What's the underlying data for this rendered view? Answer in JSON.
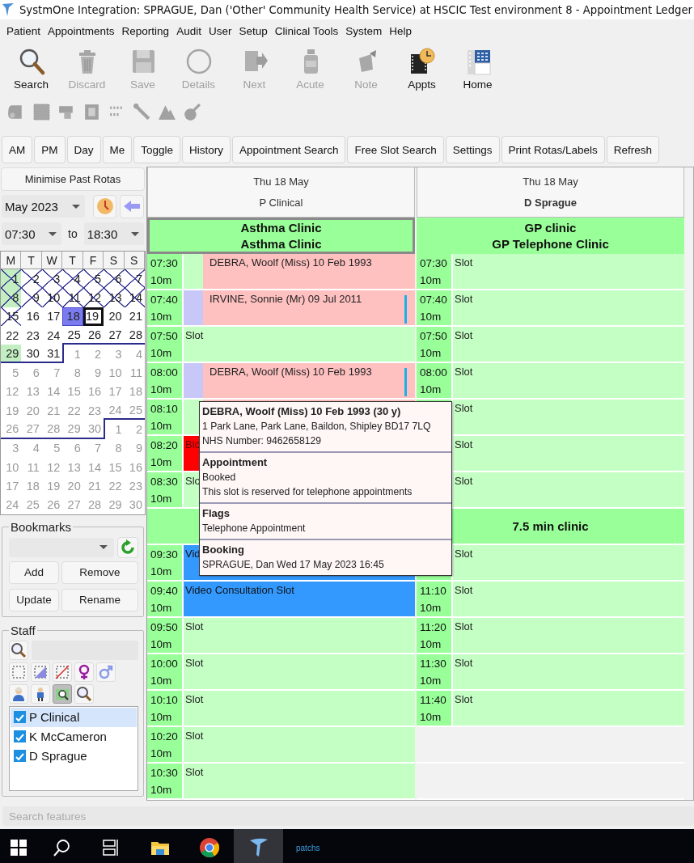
{
  "window": {
    "title": "SystmOne Integration: SPRAGUE, Dan ('Other' Community Health Service) at HSCIC Test environment 8 - Appointment Ledger"
  },
  "menu": [
    "Patient",
    "Appointments",
    "Reporting",
    "Audit",
    "User",
    "Setup",
    "Clinical Tools",
    "System",
    "Help"
  ],
  "toolbar": [
    {
      "kind": "search",
      "label": "Search",
      "disabled": false
    },
    {
      "kind": "discard",
      "label": "Discard",
      "disabled": true
    },
    {
      "kind": "save",
      "label": "Save",
      "disabled": true
    },
    {
      "kind": "details",
      "label": "Details",
      "disabled": true
    },
    {
      "kind": "next",
      "label": "Next",
      "disabled": true
    },
    {
      "kind": "acute",
      "label": "Acute",
      "disabled": true
    },
    {
      "kind": "note",
      "label": "Note",
      "disabled": true
    },
    {
      "kind": "appts",
      "label": "Appts",
      "disabled": false
    },
    {
      "kind": "home",
      "label": "Home",
      "disabled": false
    }
  ],
  "small_tools": [
    {
      "kind": "scroll",
      "disabled": true
    },
    {
      "kind": "grid",
      "disabled": true
    },
    {
      "kind": "stamp",
      "disabled": true
    },
    {
      "kind": "frame",
      "disabled": true
    },
    {
      "kind": "numbers",
      "disabled": true
    },
    {
      "kind": "tool",
      "disabled": true
    },
    {
      "kind": "mountain",
      "disabled": true
    },
    {
      "kind": "pestle",
      "disabled": true
    }
  ],
  "ledger_buttons": [
    "AM",
    "PM",
    "Day",
    "Me",
    "Toggle",
    "History",
    "Appointment Search",
    "Free Slot Search",
    "Settings",
    "Print Rotas/Labels",
    "Refresh"
  ],
  "navigator": {
    "minimise_button": "Minimise Past Rotas",
    "month": "May 2023",
    "time_from": "07:30",
    "to_label": "to",
    "time_to": "18:30",
    "calendar": {
      "weekdays": [
        "M",
        "T",
        "W",
        "T",
        "F",
        "S",
        "S"
      ],
      "weeks": [
        {
          "days": [
            {
              "day": "1",
              "kind": "current",
              "crossed": true,
              "available": true,
              "selected": false,
              "today": false
            },
            {
              "day": "2",
              "kind": "current",
              "crossed": true,
              "available": false,
              "selected": false,
              "today": false
            },
            {
              "day": "3",
              "kind": "current",
              "crossed": true,
              "available": false,
              "selected": false,
              "today": false
            },
            {
              "day": "4",
              "kind": "current",
              "crossed": true,
              "available": false,
              "selected": false,
              "today": false
            },
            {
              "day": "5",
              "kind": "current",
              "crossed": true,
              "available": false,
              "selected": false,
              "today": false
            },
            {
              "day": "6",
              "kind": "current",
              "crossed": true,
              "available": false,
              "selected": false,
              "today": false
            },
            {
              "day": "7",
              "kind": "current",
              "crossed": true,
              "available": false,
              "selected": false,
              "today": false
            }
          ]
        },
        {
          "days": [
            {
              "day": "8",
              "kind": "current",
              "crossed": true,
              "available": true,
              "selected": false,
              "today": false
            },
            {
              "day": "9",
              "kind": "current",
              "crossed": true,
              "available": false,
              "selected": false,
              "today": false
            },
            {
              "day": "10",
              "kind": "current",
              "crossed": true,
              "available": false,
              "selected": false,
              "today": false
            },
            {
              "day": "11",
              "kind": "current",
              "crossed": true,
              "available": false,
              "selected": false,
              "today": false
            },
            {
              "day": "12",
              "kind": "current",
              "crossed": true,
              "available": false,
              "selected": false,
              "today": false
            },
            {
              "day": "13",
              "kind": "current",
              "crossed": true,
              "available": false,
              "selected": false,
              "today": false
            },
            {
              "day": "14",
              "kind": "current",
              "crossed": true,
              "available": false,
              "selected": false,
              "today": false
            }
          ]
        },
        {
          "days": [
            {
              "day": "15",
              "kind": "current",
              "crossed": true,
              "available": false,
              "selected": false,
              "today": false
            },
            {
              "day": "16",
              "kind": "current",
              "crossed": false,
              "available": false,
              "selected": false,
              "today": false
            },
            {
              "day": "17",
              "kind": "current",
              "crossed": false,
              "available": false,
              "selected": false,
              "today": false
            },
            {
              "day": "18",
              "kind": "current",
              "crossed": false,
              "available": false,
              "selected": true,
              "today": false
            },
            {
              "day": "19",
              "kind": "current",
              "crossed": false,
              "available": false,
              "selected": false,
              "today": true
            },
            {
              "day": "20",
              "kind": "current",
              "crossed": false,
              "available": false,
              "selected": false,
              "today": false
            },
            {
              "day": "21",
              "kind": "current",
              "crossed": false,
              "available": false,
              "selected": false,
              "today": false
            }
          ]
        },
        {
          "days": [
            {
              "day": "22",
              "kind": "current",
              "crossed": false,
              "available": false,
              "selected": false,
              "today": false
            },
            {
              "day": "23",
              "kind": "current",
              "crossed": false,
              "available": false,
              "selected": false,
              "today": false
            },
            {
              "day": "24",
              "kind": "current",
              "crossed": false,
              "available": false,
              "selected": false,
              "today": false
            },
            {
              "day": "25",
              "kind": "current",
              "crossed": false,
              "available": false,
              "selected": false,
              "today": false
            },
            {
              "day": "26",
              "kind": "current",
              "crossed": false,
              "available": false,
              "selected": false,
              "today": false
            },
            {
              "day": "27",
              "kind": "current",
              "crossed": false,
              "available": false,
              "selected": false,
              "today": false
            },
            {
              "day": "28",
              "kind": "current",
              "crossed": false,
              "available": false,
              "selected": false,
              "today": false
            }
          ]
        },
        {
          "days": [
            {
              "day": "29",
              "kind": "current",
              "crossed": false,
              "available": true,
              "selected": false,
              "today": false
            },
            {
              "day": "30",
              "kind": "current",
              "crossed": false,
              "available": false,
              "selected": false,
              "today": false
            },
            {
              "day": "31",
              "kind": "current",
              "crossed": false,
              "available": false,
              "selected": false,
              "today": false
            },
            {
              "day": "1",
              "kind": "next",
              "crossed": false,
              "available": false,
              "selected": false,
              "today": false
            },
            {
              "day": "2",
              "kind": "next",
              "crossed": false,
              "available": false,
              "selected": false,
              "today": false
            },
            {
              "day": "3",
              "kind": "next",
              "crossed": false,
              "available": false,
              "selected": false,
              "today": false
            },
            {
              "day": "4",
              "kind": "next",
              "crossed": false,
              "available": false,
              "selected": false,
              "today": false
            }
          ]
        },
        {
          "days": [
            {
              "day": "5",
              "kind": "next",
              "crossed": false,
              "available": false,
              "selected": false,
              "today": false
            },
            {
              "day": "6",
              "kind": "next",
              "crossed": false,
              "available": false,
              "selected": false,
              "today": false
            },
            {
              "day": "7",
              "kind": "next",
              "crossed": false,
              "available": false,
              "selected": false,
              "today": false
            },
            {
              "day": "8",
              "kind": "next",
              "crossed": false,
              "available": false,
              "selected": false,
              "today": false
            },
            {
              "day": "9",
              "kind": "next",
              "crossed": false,
              "available": false,
              "selected": false,
              "today": false
            },
            {
              "day": "10",
              "kind": "next",
              "crossed": false,
              "available": false,
              "selected": false,
              "today": false
            },
            {
              "day": "11",
              "kind": "next",
              "crossed": false,
              "available": false,
              "selected": false,
              "today": false
            }
          ]
        },
        {
          "days": [
            {
              "day": "12",
              "kind": "next",
              "crossed": false,
              "available": false,
              "selected": false,
              "today": false
            },
            {
              "day": "13",
              "kind": "next",
              "crossed": false,
              "available": false,
              "selected": false,
              "today": false
            },
            {
              "day": "14",
              "kind": "next",
              "crossed": false,
              "available": false,
              "selected": false,
              "today": false
            },
            {
              "day": "15",
              "kind": "next",
              "crossed": false,
              "available": false,
              "selected": false,
              "today": false
            },
            {
              "day": "16",
              "kind": "next",
              "crossed": false,
              "available": false,
              "selected": false,
              "today": false
            },
            {
              "day": "17",
              "kind": "next",
              "crossed": false,
              "available": false,
              "selected": false,
              "today": false
            },
            {
              "day": "18",
              "kind": "next",
              "crossed": false,
              "available": false,
              "selected": false,
              "today": false
            }
          ]
        },
        {
          "days": [
            {
              "day": "19",
              "kind": "next",
              "crossed": false,
              "available": false,
              "selected": false,
              "today": false
            },
            {
              "day": "20",
              "kind": "next",
              "crossed": false,
              "available": false,
              "selected": false,
              "today": false
            },
            {
              "day": "21",
              "kind": "next",
              "crossed": false,
              "available": false,
              "selected": false,
              "today": false
            },
            {
              "day": "22",
              "kind": "next",
              "crossed": false,
              "available": false,
              "selected": false,
              "today": false
            },
            {
              "day": "23",
              "kind": "next",
              "crossed": false,
              "available": false,
              "selected": false,
              "today": false
            },
            {
              "day": "24",
              "kind": "next",
              "crossed": false,
              "available": false,
              "selected": false,
              "today": false
            },
            {
              "day": "25",
              "kind": "next",
              "crossed": false,
              "available": false,
              "selected": false,
              "today": false
            }
          ]
        },
        {
          "days": [
            {
              "day": "26",
              "kind": "next",
              "crossed": false,
              "available": false,
              "selected": false,
              "today": false
            },
            {
              "day": "27",
              "kind": "next",
              "crossed": false,
              "available": false,
              "selected": false,
              "today": false
            },
            {
              "day": "28",
              "kind": "next",
              "crossed": false,
              "available": false,
              "selected": false,
              "today": false
            },
            {
              "day": "29",
              "kind": "next",
              "crossed": false,
              "available": false,
              "selected": false,
              "today": false
            },
            {
              "day": "30",
              "kind": "next",
              "crossed": false,
              "available": false,
              "selected": false,
              "today": false
            },
            {
              "day": "1",
              "kind": "after",
              "crossed": false,
              "available": false,
              "selected": false,
              "today": false
            },
            {
              "day": "2",
              "kind": "after",
              "crossed": false,
              "available": false,
              "selected": false,
              "today": false
            }
          ]
        },
        {
          "days": [
            {
              "day": "3",
              "kind": "after",
              "crossed": false,
              "available": false,
              "selected": false,
              "today": false
            },
            {
              "day": "4",
              "kind": "after",
              "crossed": false,
              "available": false,
              "selected": false,
              "today": false
            },
            {
              "day": "5",
              "kind": "after",
              "crossed": false,
              "available": false,
              "selected": false,
              "today": false
            },
            {
              "day": "6",
              "kind": "after",
              "crossed": false,
              "available": false,
              "selected": false,
              "today": false
            },
            {
              "day": "7",
              "kind": "after",
              "crossed": false,
              "available": false,
              "selected": false,
              "today": false
            },
            {
              "day": "8",
              "kind": "after",
              "crossed": false,
              "available": false,
              "selected": false,
              "today": false
            },
            {
              "day": "9",
              "kind": "after",
              "crossed": false,
              "available": false,
              "selected": false,
              "today": false
            }
          ]
        },
        {
          "days": [
            {
              "day": "10",
              "kind": "after",
              "crossed": false,
              "available": false,
              "selected": false,
              "today": false
            },
            {
              "day": "11",
              "kind": "after",
              "crossed": false,
              "available": false,
              "selected": false,
              "today": false
            },
            {
              "day": "12",
              "kind": "after",
              "crossed": false,
              "available": false,
              "selected": false,
              "today": false
            },
            {
              "day": "13",
              "kind": "after",
              "crossed": false,
              "available": false,
              "selected": false,
              "today": false
            },
            {
              "day": "14",
              "kind": "after",
              "crossed": false,
              "available": false,
              "selected": false,
              "today": false
            },
            {
              "day": "15",
              "kind": "after",
              "crossed": false,
              "available": false,
              "selected": false,
              "today": false
            },
            {
              "day": "16",
              "kind": "after",
              "crossed": false,
              "available": false,
              "selected": false,
              "today": false
            }
          ]
        },
        {
          "days": [
            {
              "day": "17",
              "kind": "after",
              "crossed": false,
              "available": false,
              "selected": false,
              "today": false
            },
            {
              "day": "18",
              "kind": "after",
              "crossed": false,
              "available": false,
              "selected": false,
              "today": false
            },
            {
              "day": "19",
              "kind": "after",
              "crossed": false,
              "available": false,
              "selected": false,
              "today": false
            },
            {
              "day": "20",
              "kind": "after",
              "crossed": false,
              "available": false,
              "selected": false,
              "today": false
            },
            {
              "day": "21",
              "kind": "after",
              "crossed": false,
              "available": false,
              "selected": false,
              "today": false
            },
            {
              "day": "22",
              "kind": "after",
              "crossed": false,
              "available": false,
              "selected": false,
              "today": false
            },
            {
              "day": "23",
              "kind": "after",
              "crossed": false,
              "available": false,
              "selected": false,
              "today": false
            }
          ]
        },
        {
          "days": [
            {
              "day": "24",
              "kind": "after",
              "crossed": false,
              "available": false,
              "selected": false,
              "today": false
            },
            {
              "day": "25",
              "kind": "after",
              "crossed": false,
              "available": false,
              "selected": false,
              "today": false
            },
            {
              "day": "26",
              "kind": "after",
              "crossed": false,
              "available": false,
              "selected": false,
              "today": false
            },
            {
              "day": "27",
              "kind": "after",
              "crossed": false,
              "available": false,
              "selected": false,
              "today": false
            },
            {
              "day": "28",
              "kind": "after",
              "crossed": false,
              "available": false,
              "selected": false,
              "today": false
            },
            {
              "day": "29",
              "kind": "after",
              "crossed": false,
              "available": false,
              "selected": false,
              "today": false
            },
            {
              "day": "30",
              "kind": "after",
              "crossed": false,
              "available": false,
              "selected": false,
              "today": false
            }
          ]
        }
      ]
    }
  },
  "bookmarks": {
    "title": "Bookmarks",
    "buttons": [
      "Add",
      "Remove",
      "Update",
      "Rename"
    ]
  },
  "staff": {
    "title": "Staff",
    "tools": [
      {
        "kind": "select-all",
        "pressed": false
      },
      {
        "kind": "select-some",
        "pressed": false
      },
      {
        "kind": "select-none",
        "pressed": false
      },
      {
        "kind": "female",
        "pressed": false
      },
      {
        "kind": "male",
        "pressed": false
      },
      {
        "kind": "clinician",
        "pressed": false
      },
      {
        "kind": "person",
        "pressed": false
      },
      {
        "kind": "group-search",
        "pressed": true
      },
      {
        "kind": "search",
        "pressed": false
      }
    ],
    "items": [
      {
        "label": "P Clinical",
        "checked": true,
        "selected": true
      },
      {
        "label": "K McCameron",
        "checked": true,
        "selected": false
      },
      {
        "label": "D Sprague",
        "checked": true,
        "selected": false
      }
    ]
  },
  "ledger": {
    "columns": [
      {
        "date": "Thu 18 May",
        "staff": "P Clinical",
        "current_user": false,
        "session": {
          "lines": [
            "Asthma Clinic",
            "Asthma Clinic"
          ],
          "selected": true
        },
        "rows": [
          {
            "kind": "booked",
            "time": "07:30",
            "duration": "10m",
            "label": "DEBRA, Woolf (Miss) 10 Feb 1993",
            "flagged": false,
            "marked": false
          },
          {
            "kind": "booked",
            "time": "07:40",
            "duration": "10m",
            "label": "IRVINE, Sonnie (Mr) 09 Jul 2011",
            "flagged": true,
            "marked": true
          },
          {
            "kind": "slot",
            "time": "07:50",
            "duration": "10m",
            "label": "Slot"
          },
          {
            "kind": "booked",
            "time": "08:00",
            "duration": "10m",
            "label": "DEBRA, Woolf (Miss) 10 Feb 1993",
            "flagged": true,
            "marked": true
          },
          {
            "kind": "booked",
            "time": "08:10",
            "duration": "10m",
            "flagged": false
          },
          {
            "kind": "blocked",
            "time": "08:20",
            "duration": "10m",
            "label": "Blo"
          },
          {
            "kind": "slot",
            "time": "08:30",
            "duration": "10m",
            "label": "Slo"
          },
          {
            "kind": "session"
          },
          {
            "kind": "video",
            "time": "09:30",
            "duration": "10m",
            "label": "Vid"
          },
          {
            "kind": "video",
            "time": "09:40",
            "duration": "10m",
            "label": "Video Consultation Slot"
          },
          {
            "kind": "slot",
            "time": "09:50",
            "duration": "10m",
            "label": "Slot"
          },
          {
            "kind": "slot",
            "time": "10:00",
            "duration": "10m",
            "label": "Slot"
          },
          {
            "kind": "slot",
            "time": "10:10",
            "duration": "10m",
            "label": "Slot"
          },
          {
            "kind": "slot",
            "time": "10:20",
            "duration": "10m",
            "label": "Slot"
          },
          {
            "kind": "slot",
            "time": "10:30",
            "duration": "10m",
            "label": "Slot"
          }
        ]
      },
      {
        "date": "Thu 18 May",
        "staff": "D Sprague",
        "current_user": true,
        "session": {
          "lines": [
            "GP clinic",
            "GP Telephone Clinic"
          ],
          "selected": false
        },
        "rows": [
          {
            "kind": "slot",
            "time": "07:30",
            "duration": "10m",
            "label": "Slot"
          },
          {
            "kind": "slot",
            "time": "07:40",
            "duration": "10m",
            "label": "Slot"
          },
          {
            "kind": "slot",
            "time": "07:50",
            "duration": "10m",
            "label": "Slot"
          },
          {
            "kind": "slot",
            "time": "08:00",
            "duration": "10m",
            "label": "Slot"
          },
          {
            "kind": "slot",
            "label": "Slot"
          },
          {
            "kind": "slot",
            "label": "Slot"
          },
          {
            "kind": "slot",
            "label": "Slot"
          },
          {
            "kind": "session",
            "label": "7.5 min clinic"
          },
          {
            "kind": "slot",
            "label": "Slot"
          },
          {
            "kind": "slot",
            "time": "11:10",
            "duration": "10m",
            "label": "Slot"
          },
          {
            "kind": "slot",
            "time": "11:20",
            "duration": "10m",
            "label": "Slot"
          },
          {
            "kind": "slot",
            "time": "11:30",
            "duration": "10m",
            "label": "Slot"
          },
          {
            "kind": "slot",
            "time": "11:40",
            "duration": "10m",
            "label": "Slot"
          },
          {
            "kind": "empty"
          },
          {
            "kind": "empty"
          }
        ]
      }
    ]
  },
  "tooltip": {
    "sections": [
      {
        "title": "DEBRA, Woolf (Miss) 10 Feb 1993 (30 y)",
        "lines": [
          "1 Park Lane, Park Lane, Baildon, Shipley BD17 7LQ",
          "NHS Number: 9462658129"
        ]
      },
      {
        "title": "Appointment",
        "lines": [
          "Booked",
          "This slot is reserved for telephone appointments"
        ]
      },
      {
        "title": "Flags",
        "lines": [
          "Telephone Appointment"
        ]
      },
      {
        "title": "Booking",
        "lines": [
          "SPRAGUE, Dan Wed 17 May 2023 16:45"
        ]
      }
    ]
  },
  "search_features": {
    "placeholder": "Search features"
  },
  "taskbar": [
    {
      "kind": "start",
      "active": false
    },
    {
      "kind": "search",
      "active": false
    },
    {
      "kind": "taskview",
      "active": false
    },
    {
      "kind": "explorer",
      "active": false
    },
    {
      "kind": "browser",
      "active": false
    },
    {
      "kind": "app",
      "active": true
    },
    {
      "kind": "label",
      "text": "patchs",
      "active": false
    }
  ]
}
